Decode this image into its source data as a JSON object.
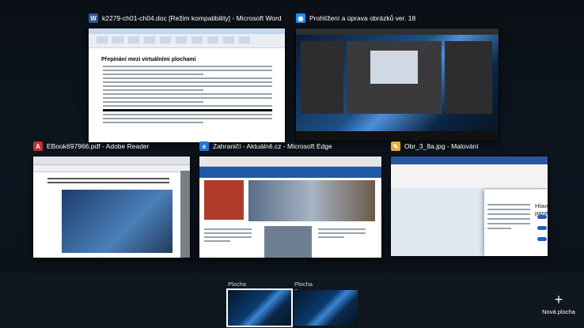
{
  "windows": [
    {
      "title": "k2279-ch01-ch04.doc [Režim kompatibility] - Microsoft Word",
      "icon": "word-icon",
      "icon_color": "#2b579a",
      "icon_text": "W",
      "doc_heading": "Přepínání mezi virtuálními plochami"
    },
    {
      "title": "Prohlížení a úprava obrázků ver. 18",
      "icon": "photo-viewer-icon",
      "icon_color": "#1e90ff",
      "icon_text": "◉"
    },
    {
      "title": "EBook697966.pdf - Adobe Reader",
      "icon": "adobe-reader-icon",
      "icon_color": "#c9302c",
      "icon_text": "A"
    },
    {
      "title": "Zahraničí - Aktuálně.cz - Microsoft Edge",
      "icon": "edge-icon",
      "icon_color": "#1e7ad4",
      "icon_text": "e"
    },
    {
      "title": "Obr_3_8a.jpg - Malování",
      "icon": "paint-icon",
      "icon_color": "#e8b03a",
      "icon_text": "✎",
      "settings_title": "Hlavní panel"
    }
  ],
  "desktops": [
    {
      "label": "Plocha 1",
      "active": true
    },
    {
      "label": "Plocha 2",
      "active": false
    }
  ],
  "new_desktop": {
    "icon": "plus-icon",
    "label": "Nová plocha"
  }
}
